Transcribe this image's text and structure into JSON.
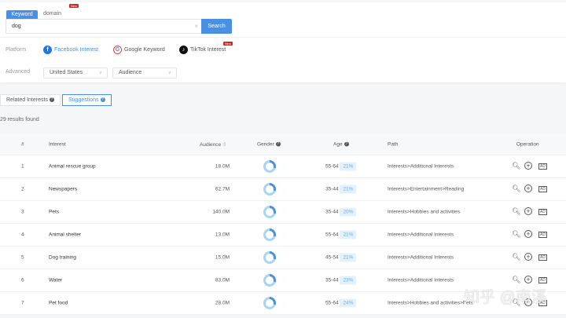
{
  "search": {
    "tabs": [
      "Keyword",
      "domain"
    ],
    "new_badge": "New",
    "query": "dog",
    "clear": "×",
    "button": "Search"
  },
  "platform": {
    "label": "Platform",
    "items": [
      "Facebook Interest",
      "Google Keyword",
      "TikTok Interest"
    ]
  },
  "advanced": {
    "label": "Advanced",
    "country": "United States",
    "audience": "Audience"
  },
  "subtabs": [
    "Related Interests",
    "Suggestions"
  ],
  "results": "29 results found",
  "table": {
    "headers": [
      "#",
      "Interest",
      "Audience",
      "Gender",
      "Age",
      "Path",
      "Operation"
    ],
    "rows": [
      {
        "n": "1",
        "interest": "Animal rescue group",
        "audience": "18.0M",
        "age": "55-64",
        "pct": "21%",
        "path": "Interests>Additional Interests"
      },
      {
        "n": "2",
        "interest": "Newspapers",
        "audience": "62.7M",
        "age": "35-44",
        "pct": "21%",
        "path": "Interests>Entertainment>Reading"
      },
      {
        "n": "3",
        "interest": "Pets",
        "audience": "140.0M",
        "age": "35-44",
        "pct": "20%",
        "path": "Interests>Hobbies and activities"
      },
      {
        "n": "4",
        "interest": "Animal shelter",
        "audience": "13.0M",
        "age": "55-64",
        "pct": "21%",
        "path": "Interests>Additional Interests"
      },
      {
        "n": "5",
        "interest": "Dog training",
        "audience": "15.0M",
        "age": "45-54",
        "pct": "21%",
        "path": "Interests>Additional Interests"
      },
      {
        "n": "6",
        "interest": "Water",
        "audience": "83.0M",
        "age": "35-44",
        "pct": "23%",
        "path": "Interests>Additional Interests"
      },
      {
        "n": "7",
        "interest": "Pet food",
        "audience": "28.0M",
        "age": "55-64",
        "pct": "24%",
        "path": "Interests>Hobbies and activities>Pets"
      }
    ]
  },
  "watermark": "知乎 @南溪"
}
